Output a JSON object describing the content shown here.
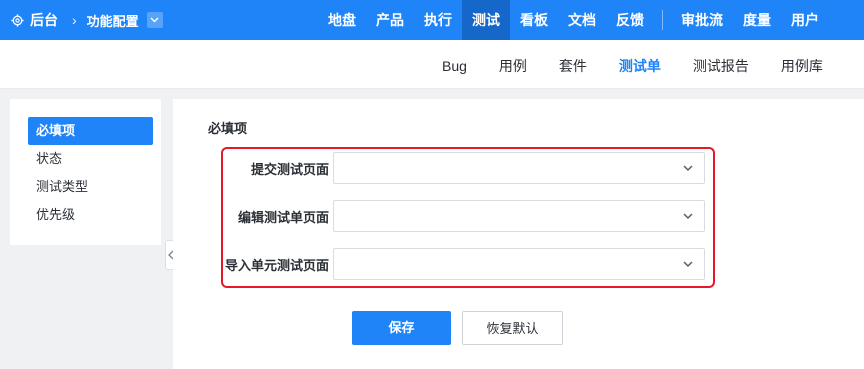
{
  "topbar": {
    "app_title": "后台",
    "breadcrumb_sep": "›",
    "module": "功能配置",
    "nav": [
      "地盘",
      "产品",
      "执行",
      "测试",
      "看板",
      "文档",
      "反馈"
    ],
    "nav_active": "测试",
    "nav_right": [
      "审批流",
      "度量",
      "用户"
    ],
    "accent_color": "#1f84f7"
  },
  "subnav": {
    "items": [
      "Bug",
      "用例",
      "套件",
      "测试单",
      "测试报告",
      "用例库"
    ],
    "active": "测试单"
  },
  "sidemenu": {
    "items": [
      "必填项",
      "状态",
      "测试类型",
      "优先级"
    ],
    "active": "必填项"
  },
  "main": {
    "section_title": "必填项",
    "fields": [
      {
        "label": "提交测试页面",
        "value": ""
      },
      {
        "label": "编辑测试单页面",
        "value": ""
      },
      {
        "label": "导入单元测试页面",
        "value": ""
      }
    ],
    "highlight_color": "#e8182b",
    "save_label": "保存",
    "reset_label": "恢复默认"
  },
  "icons": {
    "brand": "gear-icon",
    "dropdown": "chevron-down-icon",
    "collapse": "chevron-left-icon"
  }
}
